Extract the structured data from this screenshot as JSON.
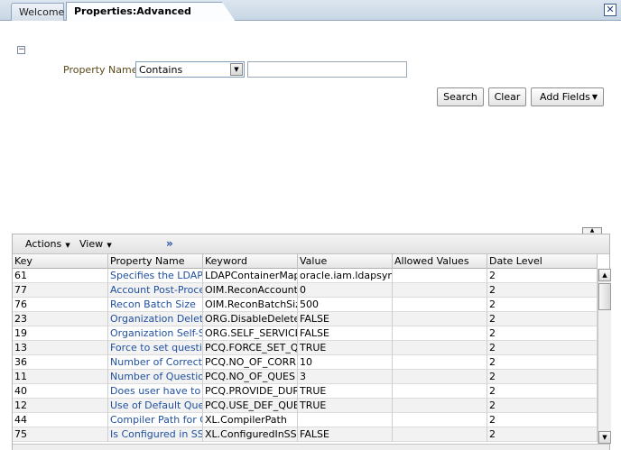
{
  "tabs": [
    {
      "label": "Welcome",
      "active": false
    },
    {
      "label": "Properties:Advanced Search",
      "active": true
    }
  ],
  "close_icon": "close-icon",
  "search": {
    "collapse_symbol": "−",
    "property_label": "Property Name",
    "operator_value": "Contains",
    "text_value": "",
    "buttons": {
      "search": "Search",
      "clear": "Clear",
      "add_fields": "Add Fields"
    }
  },
  "toolbar": {
    "actions": "Actions",
    "view": "View",
    "more": "»"
  },
  "table": {
    "columns": [
      "Key",
      "Property Name",
      "Keyword",
      "Value",
      "Allowed Values",
      "Date Level"
    ],
    "rows": [
      [
        "61",
        "Specifies the LDAP co",
        "LDAPContainerMappe",
        "oracle.iam.ldapsync.i",
        "",
        "2"
      ],
      [
        "77",
        "Account Post-Process",
        "OIM.ReconAccountPo",
        "0",
        "",
        "2"
      ],
      [
        "76",
        "Recon Batch Size",
        "OIM.ReconBatchSize",
        "500",
        "",
        "2"
      ],
      [
        "23",
        "Organization Delete/D",
        "ORG.DisableDeleteAc",
        "FALSE",
        "",
        "2"
      ],
      [
        "19",
        "Organization Self-Ser",
        "ORG.SELF_SERVICEA",
        "FALSE",
        "",
        "2"
      ],
      [
        "13",
        "Force to set question",
        "PCQ.FORCE_SET_QU",
        "TRUE",
        "",
        "2"
      ],
      [
        "36",
        "Number of Correct An",
        "PCQ.NO_OF_CORRE",
        "10",
        "",
        "2"
      ],
      [
        "11",
        "Number of Questions",
        "PCQ.NO_OF_QUES",
        "3",
        "",
        "2"
      ],
      [
        "40",
        "Does user have to pro",
        "PCQ.PROVIDE_DURIN",
        "TRUE",
        "",
        "2"
      ],
      [
        "12",
        "Use of Default Questi",
        "PCQ.USE_DEF_QUES",
        "TRUE",
        "",
        "2"
      ],
      [
        "44",
        "Compiler Path for Cor",
        "XL.CompilerPath",
        "",
        "",
        "2"
      ],
      [
        "75",
        "Is Configured in SSI M",
        "XL.ConfiguredInSSIM",
        "FALSE",
        "",
        "2"
      ]
    ]
  }
}
